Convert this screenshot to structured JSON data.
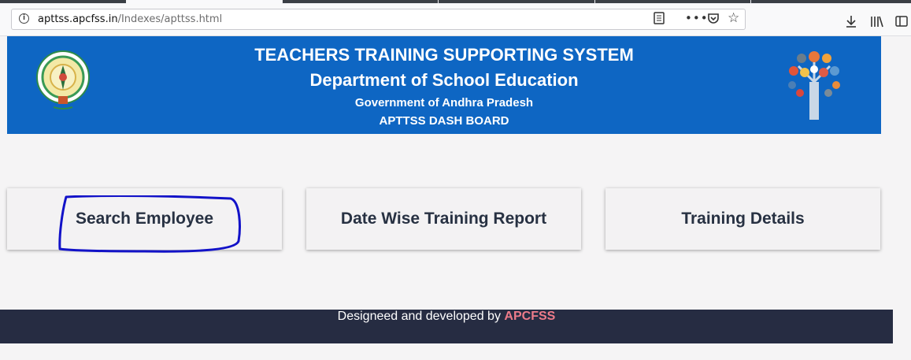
{
  "browser": {
    "url_domain": "apttss.apcfss.in",
    "url_path": "/Indexes/apttss.html",
    "icons": [
      "info-icon",
      "reader-mode-icon",
      "more-icon",
      "pocket-icon",
      "bookmark-star-icon",
      "downloads-icon",
      "library-icon",
      "sidebar-icon"
    ]
  },
  "header": {
    "title": "TEACHERS TRAINING SUPPORTING SYSTEM",
    "department": "Department of School Education",
    "government": "Government of Andhra Pradesh",
    "dashboard": "APTTSS DASH BOARD",
    "background_color": "#0e66c3"
  },
  "menu": {
    "items": [
      {
        "label": "Search Employee"
      },
      {
        "label": "Date Wise Training Report"
      },
      {
        "label": "Training Details"
      }
    ]
  },
  "footer": {
    "text": "Designeed and developed by",
    "brand": "APCFSS",
    "brand_color": "#ee7b8a",
    "background_color": "#262c42"
  }
}
